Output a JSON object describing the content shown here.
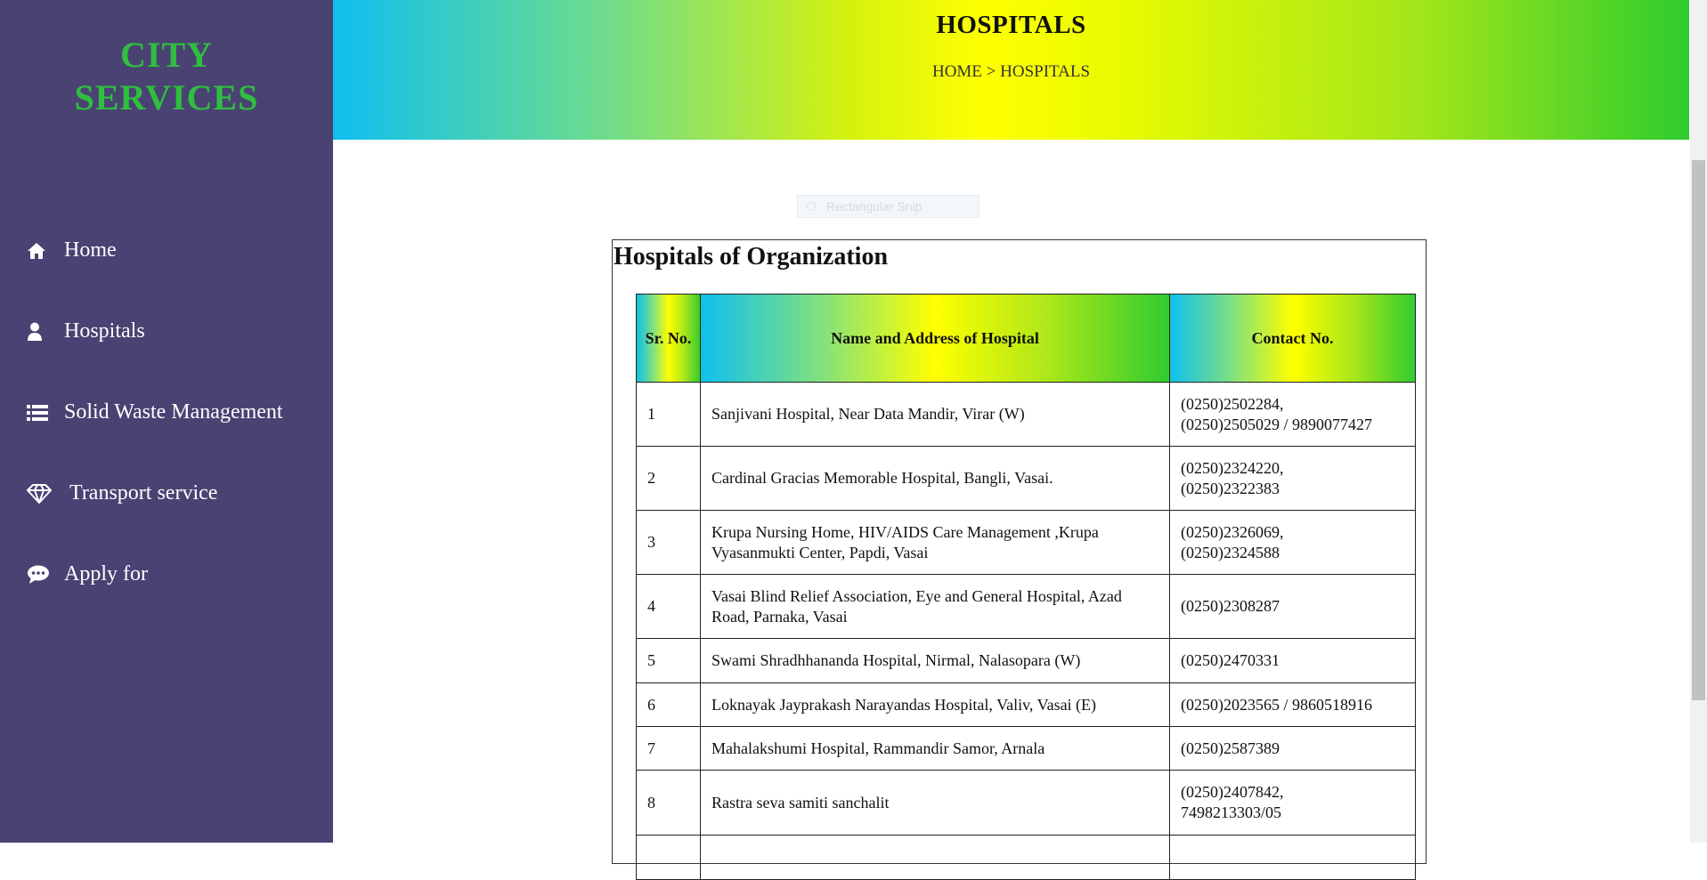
{
  "sidebar": {
    "brand_line1": "CITY",
    "brand_line2": "SERVICES",
    "items": [
      {
        "label": "Home",
        "icon": "home-icon"
      },
      {
        "label": "Hospitals",
        "icon": "user-icon"
      },
      {
        "label": "Solid Waste Management",
        "icon": "list-icon"
      },
      {
        "label": "Transport service",
        "icon": "diamond-icon"
      },
      {
        "label": "Apply for",
        "icon": "chat-icon"
      }
    ]
  },
  "header": {
    "title": "HOSPITALS",
    "breadcrumb": "HOME > HOSPITALS"
  },
  "overlay": {
    "snip_label": "Rectangular Snip"
  },
  "main": {
    "title": "Hospitals of Organization",
    "columns": [
      "Sr. No.",
      "Name and Address of Hospital",
      "Contact No."
    ],
    "rows": [
      {
        "sr": "1",
        "name": "Sanjivani Hospital, Near Data Mandir, Virar (W)",
        "contact_1": "(0250)2502284,",
        "contact_2": "(0250)2505029 / 9890077427"
      },
      {
        "sr": "2",
        "name": "Cardinal Gracias Memorable Hospital, Bangli, Vasai.",
        "contact_1": "(0250)2324220,",
        "contact_2": "(0250)2322383"
      },
      {
        "sr": "3",
        "name": "Krupa Nursing Home, HIV/AIDS Care Management ,Krupa Vyasanmukti Center, Papdi, Vasai",
        "contact_1": "(0250)2326069,",
        "contact_2": "(0250)2324588"
      },
      {
        "sr": "4",
        "name": "Vasai Blind Relief Association, Eye and General Hospital, Azad Road, Parnaka, Vasai",
        "contact_1": "(0250)2308287",
        "contact_2": ""
      },
      {
        "sr": "5",
        "name": "Swami Shradhhananda Hospital, Nirmal, Nalasopara (W)",
        "contact_1": "(0250)2470331",
        "contact_2": ""
      },
      {
        "sr": "6",
        "name": "Loknayak Jayprakash Narayandas Hospital, Valiv, Vasai (E)",
        "contact_1": "(0250)2023565 / 9860518916",
        "contact_2": ""
      },
      {
        "sr": "7",
        "name": "Mahalakshumi Hospital, Rammandir Samor, Arnala",
        "contact_1": "(0250)2587389",
        "contact_2": ""
      },
      {
        "sr": "8",
        "name": "Rastra seva samiti sanchalit",
        "contact_1": "(0250)2407842,",
        "contact_2": "7498213303/05"
      },
      {
        "sr": "",
        "name": "",
        "contact_1": "",
        "contact_2": ""
      }
    ]
  },
  "colors": {
    "sidebar_bg": "#4a4273",
    "brand": "#2fbf3f",
    "banner_start": "#0fbfef",
    "banner_mid": "#ffff00",
    "banner_end": "#2ecc2e"
  }
}
